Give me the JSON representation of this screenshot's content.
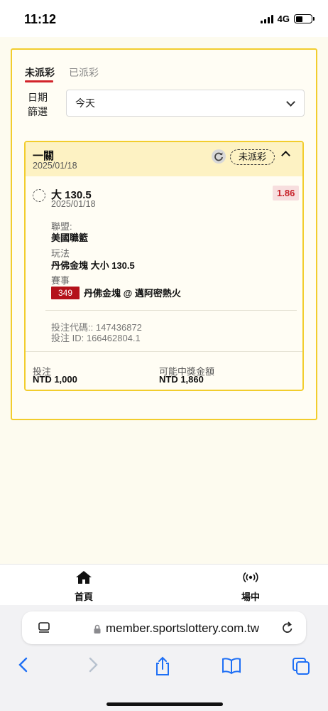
{
  "status_bar": {
    "time": "11:12",
    "network": "4G"
  },
  "tabs": {
    "unpaid": "未派彩",
    "paid": "已派彩"
  },
  "date_filter": {
    "label": "日期篩選",
    "value": "今天"
  },
  "bet": {
    "type": "一關",
    "date": "2025/01/18",
    "status": "未派彩",
    "pick": "大 130.5",
    "pick_date": "2025/01/18",
    "odds": "1.86",
    "league_label": "聯盟:",
    "league_value": "美國職籃",
    "market_label": "玩法",
    "market_value": "丹佛金塊 大小 130.5",
    "event_label": "賽事",
    "event_number": "349",
    "event_name": "丹佛金塊 @ 邁阿密熱火",
    "bet_code": "投注代碼:: 147436872",
    "bet_id": "投注 ID: 166462804.1",
    "stake_label": "投注",
    "stake_value": "NTD 1,000",
    "payout_label": "可能中獎金額",
    "payout_value": "NTD 1,860"
  },
  "bottom_nav": {
    "home": "首頁",
    "live": "場中"
  },
  "browser": {
    "url": "member.sportslottery.com.tw"
  },
  "colors": {
    "accent_red": "#d2232a",
    "border_yellow": "#f2cd2d",
    "header_yellow": "#fdf2c3",
    "odds_bg": "#f7dede",
    "event_red": "#b4121a"
  },
  "icons": [
    "refresh-icon",
    "chevron-up-icon",
    "chevron-down-icon",
    "home-icon",
    "broadcast-icon",
    "lock-icon",
    "reader-icon",
    "reload-icon",
    "back-icon",
    "forward-icon",
    "share-icon",
    "bookmarks-icon",
    "tabs-icon"
  ]
}
